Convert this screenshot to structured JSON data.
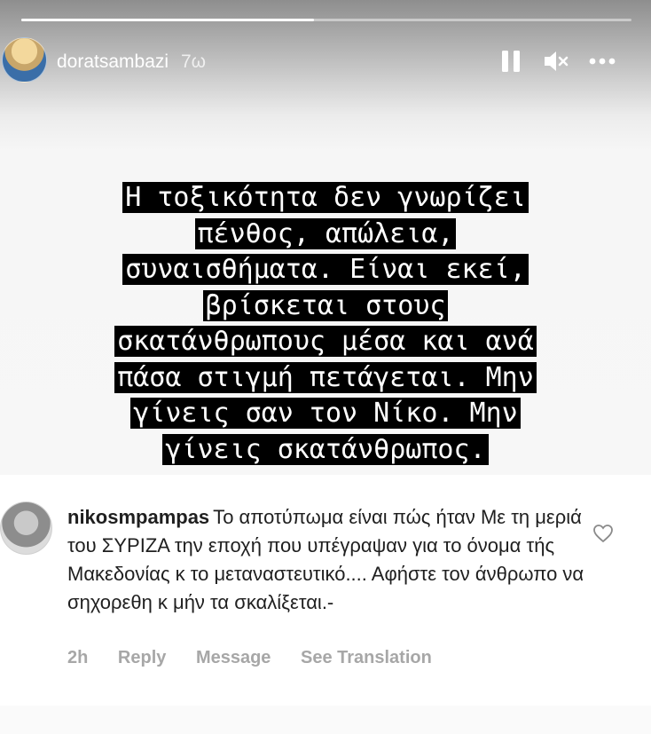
{
  "story": {
    "progress": 0.48,
    "username": "doratsambazi",
    "time_ago": "7ω",
    "text_lines": [
      "Η τοξικότητα δεν γνωρίζει",
      "πένθος, απώλεια,",
      "συναισθήματα. Είναι εκεί,",
      "βρίσκεται στους",
      "σκατάνθρωπους μέσα και ανά",
      "πάσα στιγμή πετάγεται. Μην",
      "γίνεις σαν τον Νίκο. Μην",
      "γίνεις σκατάνθρωπος."
    ]
  },
  "comment": {
    "username": "nikosmpampas",
    "text": "Το αποτύπωμα είναι πώς ήταν Με τη μεριά του ΣΥΡΙΖΑ την εποχή που υπέγραψαν για το όνομα τής Μακεδονίας κ το μεταναστευτικό.... Αφήστε τον άνθρωπο να σηχορεθη κ μήν τα σκαλίξεται.-",
    "time": "2h",
    "reply_label": "Reply",
    "message_label": "Message",
    "translation_label": "See Translation"
  },
  "icons": [
    "pause-icon",
    "mute-icon",
    "more-icon",
    "heart-icon"
  ]
}
